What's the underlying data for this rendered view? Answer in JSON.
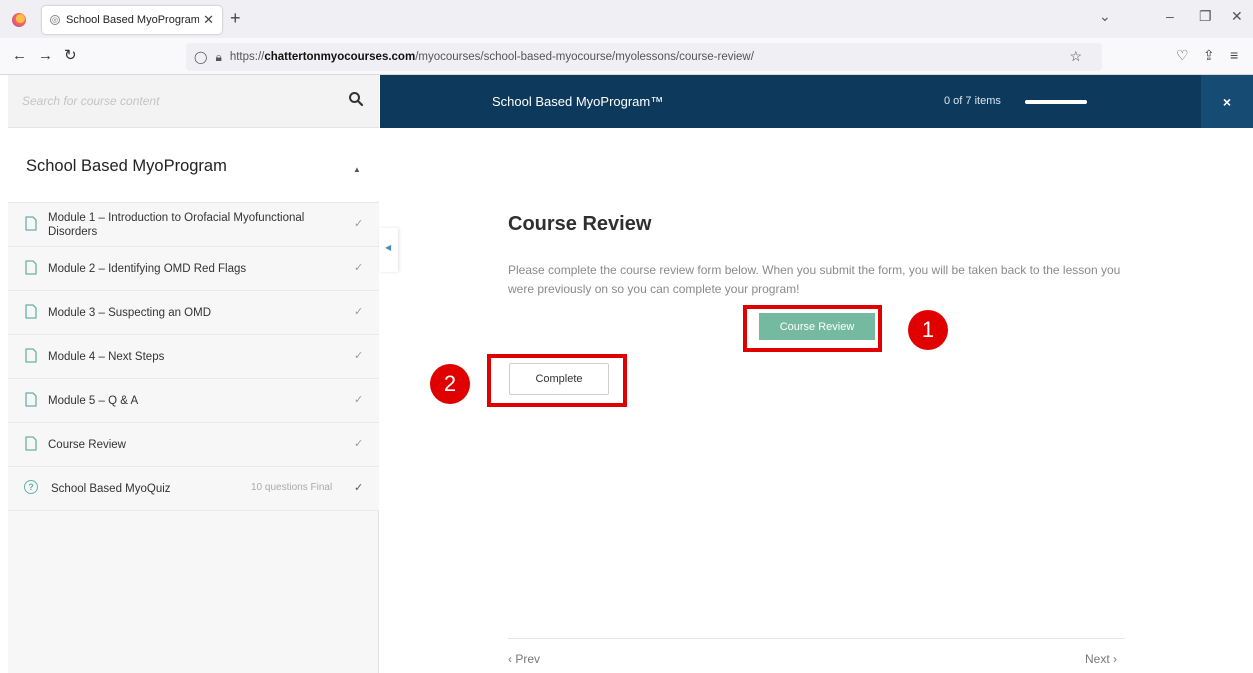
{
  "browser": {
    "tab_title": "School Based MyoProgram™ — ",
    "tab_close": "✕",
    "new_tab": "+",
    "url_prefix": "https://",
    "url_host": "chattertonmyocourses.com",
    "url_path": "/myocourses/school-based-myocourse/myolessons/course-review/"
  },
  "sidebar": {
    "search_placeholder": "Search for course content",
    "course_title": "School Based MyoProgram",
    "lessons": [
      {
        "label": "Module 1 – Introduction to Orofacial Myofunctional Disorders"
      },
      {
        "label": "Module 2 – Identifying OMD Red Flags"
      },
      {
        "label": "Module 3 – Suspecting an OMD"
      },
      {
        "label": "Module 4 – Next Steps"
      },
      {
        "label": "Module 5 – Q & A"
      },
      {
        "label": "Course Review"
      }
    ],
    "quiz": {
      "label": "School Based MyoQuiz",
      "meta": "10 questions   Final"
    }
  },
  "topbar": {
    "course_title": "School Based MyoProgram™",
    "progress_text": "0 of 7 items",
    "progress_fraction": 0.0,
    "close": "×"
  },
  "main": {
    "heading": "Course Review",
    "paragraph": "Please complete the course review form below. When you submit the form, you will be taken back to the lesson you were previously on so you can complete your program!",
    "course_review_button": "Course Review",
    "complete_button": "Complete",
    "prev": "‹  Prev",
    "next": "Next  ›"
  },
  "annotations": {
    "badge1": "1",
    "badge2": "2",
    "color": "#e00000"
  },
  "colors": {
    "topbar": "#0d3a5c",
    "accent": "#74b9a0"
  }
}
